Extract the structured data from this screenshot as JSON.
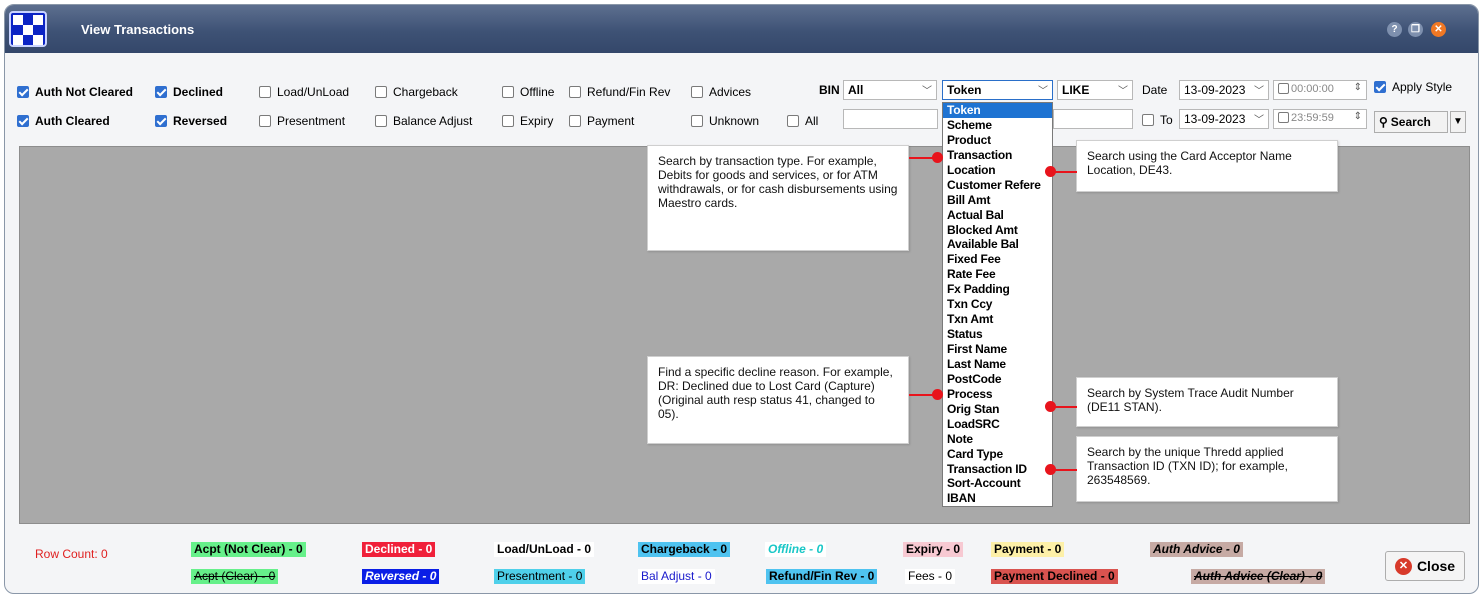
{
  "window": {
    "title": "View Transactions"
  },
  "filters": {
    "row1": [
      {
        "label": "Auth Not Cleared",
        "checked": true,
        "bold": true
      },
      {
        "label": "Declined",
        "checked": true,
        "bold": true
      },
      {
        "label": "Load/UnLoad",
        "checked": false,
        "bold": false
      },
      {
        "label": "Chargeback",
        "checked": false,
        "bold": false
      },
      {
        "label": "Offline",
        "checked": false,
        "bold": false
      },
      {
        "label": "Refund/Fin Rev",
        "checked": false,
        "bold": false
      },
      {
        "label": "Advices",
        "checked": false,
        "bold": false
      }
    ],
    "row2": [
      {
        "label": "Auth Cleared",
        "checked": true,
        "bold": true
      },
      {
        "label": "Reversed",
        "checked": true,
        "bold": true
      },
      {
        "label": "Presentment",
        "checked": false,
        "bold": false
      },
      {
        "label": "Balance Adjust",
        "checked": false,
        "bold": false
      },
      {
        "label": "Expiry",
        "checked": false,
        "bold": false
      },
      {
        "label": "Payment",
        "checked": false,
        "bold": false
      },
      {
        "label": "Unknown",
        "checked": false,
        "bold": false
      },
      {
        "label": "All",
        "checked": false,
        "bold": false
      }
    ]
  },
  "search": {
    "bin_label": "BIN",
    "bin_value": "All",
    "field_value": "Token",
    "operator_value": "LIKE",
    "date_label": "Date",
    "date_from": "13-09-2023",
    "time_from": "00:00:00",
    "to_label": "To",
    "date_to": "13-09-2023",
    "time_to": "23:59:59",
    "apply_style_label": "Apply Style",
    "apply_style_checked": true,
    "search_label": "Search"
  },
  "field_options": [
    "Token",
    "Scheme",
    "Product",
    "Transaction",
    "Location",
    "Customer Refere",
    "Bill Amt",
    "Actual Bal",
    "Blocked Amt",
    "Available Bal",
    "Fixed Fee",
    "Rate Fee",
    "Fx Padding",
    "Txn Ccy",
    "Txn Amt",
    "Status",
    "First Name",
    "Last Name",
    "PostCode",
    "Process",
    "Orig Stan",
    "LoadSRC",
    "Note",
    "Card Type",
    "Transaction ID",
    "Sort-Account",
    "IBAN"
  ],
  "callouts": {
    "transaction": "Search by transaction type. For example, Debits for goods and services, or for ATM withdrawals, or for cash disbursements using Maestro cards.",
    "location": "Search using the Card Acceptor Name Location, DE43.",
    "process": "Find a specific decline reason. For example, DR: Declined due to Lost Card (Capture)(Original auth resp status 41, changed to 05).",
    "orig_stan": "Search by System Trace Audit Number (DE11 STAN).",
    "transaction_id": "Search by the unique Thredd applied Transaction ID (TXN ID); for example, 263548569."
  },
  "footer": {
    "row_count": "Row Count: 0",
    "legend_row1": [
      {
        "label": "Acpt (Not Clear) - 0",
        "bg": "#66f08a",
        "color": "#000000",
        "italic": false,
        "strike": false
      },
      {
        "label": "Declined - 0",
        "bg": "#f0203a",
        "color": "#ffffff",
        "italic": false,
        "strike": false
      },
      {
        "label": "Load/UnLoad - 0",
        "bg": "#ffffff",
        "color": "#000000",
        "italic": false,
        "strike": false
      },
      {
        "label": "Chargeback - 0",
        "bg": "#4fc3f0",
        "color": "#000000",
        "italic": false,
        "strike": false
      },
      {
        "label": "Offline - 0",
        "bg": "#ffffff",
        "color": "#19c7c7",
        "italic": true,
        "strike": false
      },
      {
        "label": "Expiry - 0",
        "bg": "#f7c9d2",
        "color": "#000000",
        "italic": false,
        "strike": false
      },
      {
        "label": "Payment - 0",
        "bg": "#fdf0a8",
        "color": "#000000",
        "italic": false,
        "strike": false
      },
      {
        "label": "Auth Advice - 0",
        "bg": "#c6aaa4",
        "color": "#000000",
        "italic": true,
        "strike": false
      }
    ],
    "legend_row2": [
      {
        "label": "Acpt (Clear) - 0",
        "bg": "#66f08a",
        "color": "#000000",
        "italic": false,
        "strike": true
      },
      {
        "label": "Reversed - 0",
        "bg": "#0a1ee6",
        "color": "#ffffff",
        "italic": true,
        "strike": false
      },
      {
        "label": "Presentment - 0",
        "bg": "#4fd0ea",
        "color": "#000000",
        "italic": false,
        "strike": false
      },
      {
        "label": "Bal Adjust - 0",
        "bg": "#ffffff",
        "color": "#1a1acc",
        "italic": false,
        "strike": false
      },
      {
        "label": "Refund/Fin Rev - 0",
        "bg": "#4fc3f0",
        "color": "#000000",
        "italic": false,
        "strike": false
      },
      {
        "label": "Fees - 0",
        "bg": "#ffffff",
        "color": "#000000",
        "italic": false,
        "strike": false
      },
      {
        "label": "Payment Declined - 0",
        "bg": "#d9534f",
        "color": "#000000",
        "italic": false,
        "strike": false
      },
      {
        "label": "Auth Advice (Clear) - 0",
        "bg": "#c6aaa4",
        "color": "#000000",
        "italic": true,
        "strike": true
      }
    ],
    "close_label": "Close"
  }
}
